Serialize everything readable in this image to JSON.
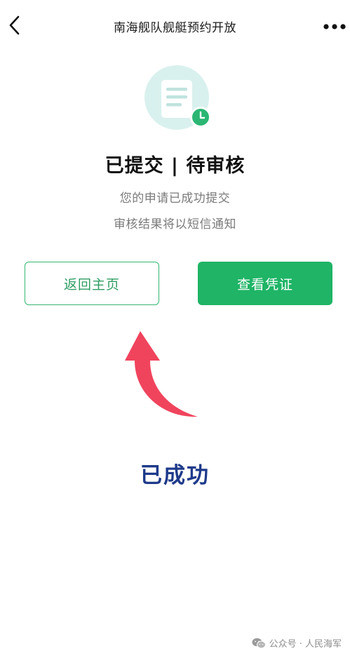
{
  "nav": {
    "title": "南海舰队舰艇预约开放",
    "back_icon": "chevron-left-icon",
    "more_icon": "more-dots-icon"
  },
  "status": {
    "title": "已提交 | 待审核",
    "line1": "您的申请已成功提交",
    "line2": "审核结果将以短信通知",
    "illustration_icon": "document-pending-icon"
  },
  "buttons": {
    "home_label": "返回主页",
    "voucher_label": "查看凭证"
  },
  "annotation": {
    "text": "已成功",
    "arrow_icon": "curved-arrow-up-icon"
  },
  "watermark": {
    "text": "公众号 · 人民海军",
    "icon": "wechat-icon"
  },
  "colors": {
    "primary_green": "#1fb466",
    "outline_green": "#35b771",
    "arrow_red": "#f0445d",
    "annotation_blue": "#1e3a8a",
    "illustration_bg": "#d9f1ee"
  }
}
